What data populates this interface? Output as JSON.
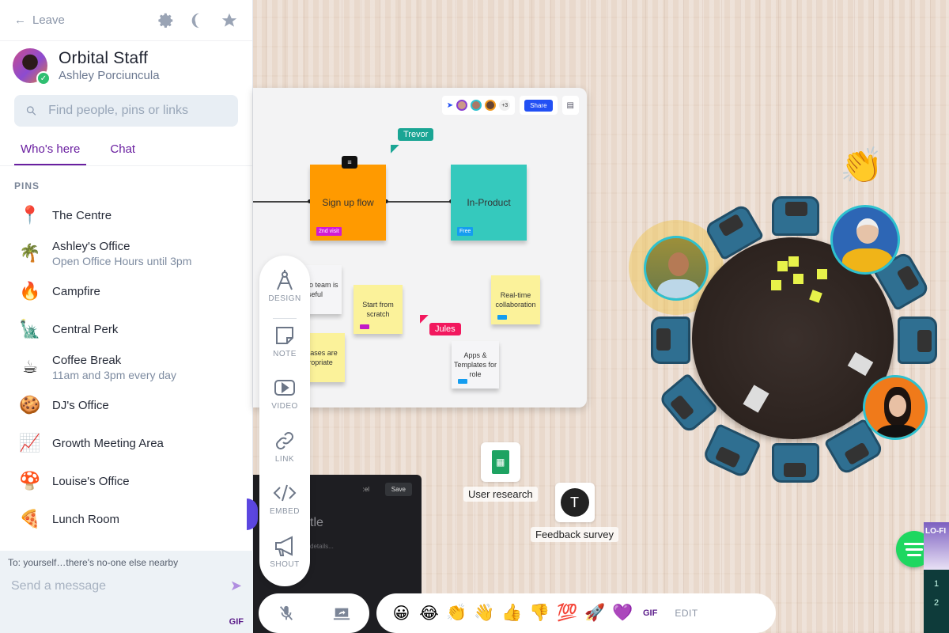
{
  "sidebar": {
    "leave_label": "Leave",
    "header_icons": [
      "gear-icon",
      "moon-icon",
      "star-icon"
    ],
    "space_name": "Orbital Staff",
    "user_name": "Ashley Porciuncula",
    "search_placeholder": "Find people, pins or links",
    "tabs": [
      {
        "label": "Who's here",
        "active": true
      },
      {
        "label": "Chat",
        "active": false
      }
    ],
    "pins_heading": "PINS",
    "pins": [
      {
        "icon": "📍",
        "name": "The Centre",
        "sub": ""
      },
      {
        "icon": "🌴",
        "name": "Ashley's Office",
        "sub": "Open Office Hours until 3pm"
      },
      {
        "icon": "🔥",
        "name": "Campfire",
        "sub": ""
      },
      {
        "icon": "🗽",
        "name": "Central Perk",
        "sub": ""
      },
      {
        "icon": "☕",
        "name": "Coffee Break",
        "sub": "11am and 3pm every day"
      },
      {
        "icon": "🍪",
        "name": "DJ's Office",
        "sub": ""
      },
      {
        "icon": "📈",
        "name": "Growth Meeting Area",
        "sub": ""
      },
      {
        "icon": "🍄",
        "name": "Louise's Office",
        "sub": ""
      },
      {
        "icon": "🍕",
        "name": "Lunch Room",
        "sub": ""
      }
    ],
    "chat": {
      "to_label": "To: yourself…there's no-one else nearby",
      "placeholder": "Send a message",
      "gif_label": "GIF"
    }
  },
  "whiteboard": {
    "overflow_count": "+3",
    "share_label": "Share",
    "cursors": [
      {
        "name": "Trevor",
        "color": "#1aa594"
      },
      {
        "name": "Jules",
        "color": "#f2185e"
      }
    ],
    "stickies": [
      {
        "text": "Sign up flow",
        "tag": "2nd visit",
        "color": "#ff9a00",
        "tag_color": "#d21ad2"
      },
      {
        "text": "In-Product",
        "tag": "Free",
        "color": "#35c9bd",
        "tag_color": "#149df0"
      },
      {
        "text": "Invite to team is useful",
        "tag": "",
        "color": "#f5f5f7",
        "tag_color": ""
      },
      {
        "text": "Start from scratch",
        "tag": "",
        "color": "#fbf29a",
        "tag_color": "#c21ac7"
      },
      {
        "text": "Real-time collaboration",
        "tag": "",
        "color": "#fbf29a",
        "tag_color": "#149df0"
      },
      {
        "text": "Use cases are appropriate",
        "tag": "",
        "color": "#fbf29a",
        "tag_color": ""
      },
      {
        "text": "Apps & Templates for role",
        "tag": "",
        "color": "#f5f5f7",
        "tag_color": "#149df0"
      }
    ]
  },
  "toolrail": [
    {
      "label": "DESIGN",
      "icon": "compass-icon"
    },
    {
      "label": "NOTE",
      "icon": "note-icon"
    },
    {
      "label": "VIDEO",
      "icon": "video-icon"
    },
    {
      "label": "LINK",
      "icon": "link-icon"
    },
    {
      "label": "EMBED",
      "icon": "embed-icon"
    },
    {
      "label": "SHOUT",
      "icon": "megaphone-icon"
    }
  ],
  "darkcard": {
    "save_label": "Save",
    "cancel_fragment": ":el",
    "title_fragment": "tle",
    "desc_fragment": "details..."
  },
  "apps": [
    {
      "label": "User research",
      "icon": "google-sheets-icon"
    },
    {
      "label": "Feedback survey",
      "icon": "typeform-icon",
      "glyph": "T"
    }
  ],
  "mediabar": {
    "mic_state": "muted",
    "screenshare": "screenshare-icon"
  },
  "reactions": [
    "😀",
    "😂",
    "👏",
    "👋",
    "👍",
    "👎",
    "💯",
    "🚀",
    "💜"
  ],
  "reaction_gif_label": "GIF",
  "reaction_edit_label": "EDIT",
  "clap_reaction": "👏",
  "spotify_panel": {
    "title": "LO-FI",
    "tracks": [
      "1",
      "2"
    ]
  }
}
